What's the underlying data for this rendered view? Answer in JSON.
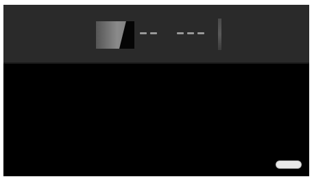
{
  "header": {
    "logo_icon": "brand-logo-icon",
    "dash_groups": [
      2,
      3
    ]
  },
  "corner_button": {
    "label": ""
  },
  "colors": {
    "header_background": "#2a2a2a",
    "main_background": "#000000",
    "button_background": "#e8e8e8"
  }
}
